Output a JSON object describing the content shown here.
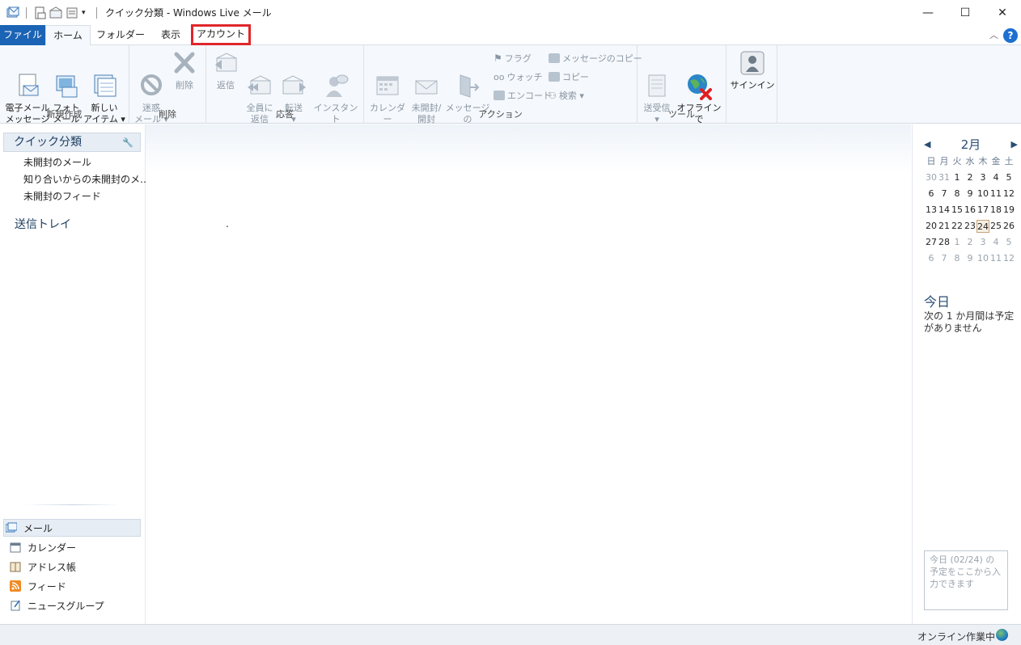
{
  "window": {
    "title": "クイック分類 - Windows Live メール",
    "controls": {
      "minimize": "—",
      "maximize": "☐",
      "close": "✕"
    }
  },
  "tabs": [
    {
      "label": "ファイル"
    },
    {
      "label": "ホーム"
    },
    {
      "label": "フォルダー"
    },
    {
      "label": "表示"
    },
    {
      "label": "アカウント"
    }
  ],
  "ribbon": {
    "new_group": {
      "label": "新規作成",
      "email": "電子メール\nメッセージ",
      "photo": "フォト\nメール",
      "new_item": "新しい\nアイテム ▾"
    },
    "delete_group": {
      "label": "削除",
      "junk": "迷惑\nメール ▾",
      "delete": "削除"
    },
    "respond_group": {
      "label": "応答",
      "reply": "返信",
      "reply_all": "全員に\n返信",
      "forward": "転送\n▾",
      "im": "インスタント\nメッセージ"
    },
    "actions_group": {
      "label": "アクション",
      "add_calendar": "カレンダー\nに追加",
      "unread": "未開封/\n開封",
      "move": "メッセージの\n移動",
      "flag": "フラグ",
      "watch": "ウォッチ",
      "encode": "エンコード",
      "copy_msg": "メッセージのコピー",
      "copy": "コピー",
      "find": "検索 ▾"
    },
    "tools_group": {
      "label": "ツール",
      "send_receive": "送受信\n▾",
      "offline": "オフラインで\n作業"
    },
    "signin_group": {
      "signin": "サインイン"
    }
  },
  "left_nav": {
    "quick_views": "クイック分類",
    "items": [
      {
        "label": "未開封のメール"
      },
      {
        "label": "知り合いからの未開封のメ…"
      },
      {
        "label": "未開封のフィード"
      }
    ],
    "outbox": "送信トレイ",
    "bottom": [
      {
        "label": "メール"
      },
      {
        "label": "カレンダー"
      },
      {
        "label": "アドレス帳"
      },
      {
        "label": "フィード"
      },
      {
        "label": "ニュースグループ"
      }
    ]
  },
  "main": {
    "dot": "."
  },
  "calendar": {
    "month": "2月",
    "weekdays": [
      "日",
      "月",
      "火",
      "水",
      "木",
      "金",
      "土"
    ],
    "weeks": [
      [
        "30",
        "31",
        "1",
        "2",
        "3",
        "4",
        "5"
      ],
      [
        "6",
        "7",
        "8",
        "9",
        "10",
        "11",
        "12"
      ],
      [
        "13",
        "14",
        "15",
        "16",
        "17",
        "18",
        "19"
      ],
      [
        "20",
        "21",
        "22",
        "23",
        "24",
        "25",
        "26"
      ],
      [
        "27",
        "28",
        "1",
        "2",
        "3",
        "4",
        "5"
      ],
      [
        "6",
        "7",
        "8",
        "9",
        "10",
        "11",
        "12"
      ]
    ],
    "today_day": "24",
    "today_title": "今日",
    "today_text": "次の 1 か月間は予定がありません",
    "quick_placeholder": "今日 (02/24) の予定をここから入力できます"
  },
  "status": {
    "text": "オンライン作業中"
  }
}
